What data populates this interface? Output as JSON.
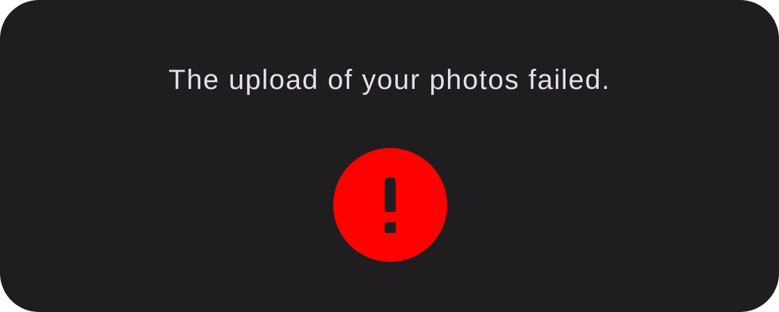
{
  "dialog": {
    "message": "The upload of your photos failed.",
    "icon": "error-alert-icon",
    "colors": {
      "background": "#1f1d20",
      "text": "#e6e0e9",
      "error": "#ff0000"
    }
  }
}
